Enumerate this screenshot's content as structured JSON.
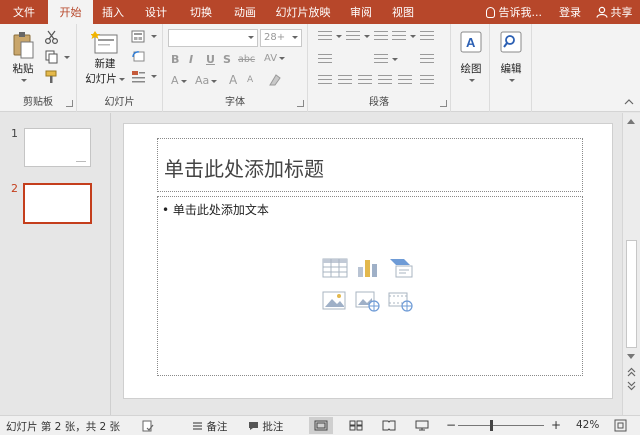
{
  "tabs": [
    "文件",
    "开始",
    "插入",
    "设计",
    "切换",
    "动画",
    "幻灯片放映",
    "审阅",
    "视图"
  ],
  "active_tab_index": 1,
  "tell_me": "告诉我...",
  "login": "登录",
  "share": "共享",
  "ribbon": {
    "clipboard": {
      "paste": "粘贴",
      "label": "剪贴板"
    },
    "slides": {
      "new_slide_line1": "新建",
      "new_slide_line2": "幻灯片",
      "label": "幻灯片"
    },
    "font": {
      "font_size": "28+",
      "bold": "B",
      "italic": "I",
      "underline": "U",
      "shadow": "S",
      "strike": "abc",
      "spacing": "AV",
      "grow": "A",
      "shrink": "A",
      "case": "Aa",
      "label": "字体"
    },
    "paragraph": {
      "label": "段落"
    },
    "drawing": {
      "label": "绘图"
    },
    "editing": {
      "label": "编辑"
    }
  },
  "thumbnails": [
    {
      "number": "1"
    },
    {
      "number": "2"
    }
  ],
  "selected_slide": 2,
  "slide": {
    "title_placeholder": "单击此处添加标题",
    "body_placeholder": "• 单击此处添加文本"
  },
  "status": {
    "slide_info": "幻灯片 第 2 张，共 2 张",
    "notes": "备注",
    "comments": "批注",
    "zoom": "42%",
    "zoom_fraction": 0.42
  },
  "colors": {
    "accent": "#b7472a",
    "selection": "#c43e1c"
  }
}
